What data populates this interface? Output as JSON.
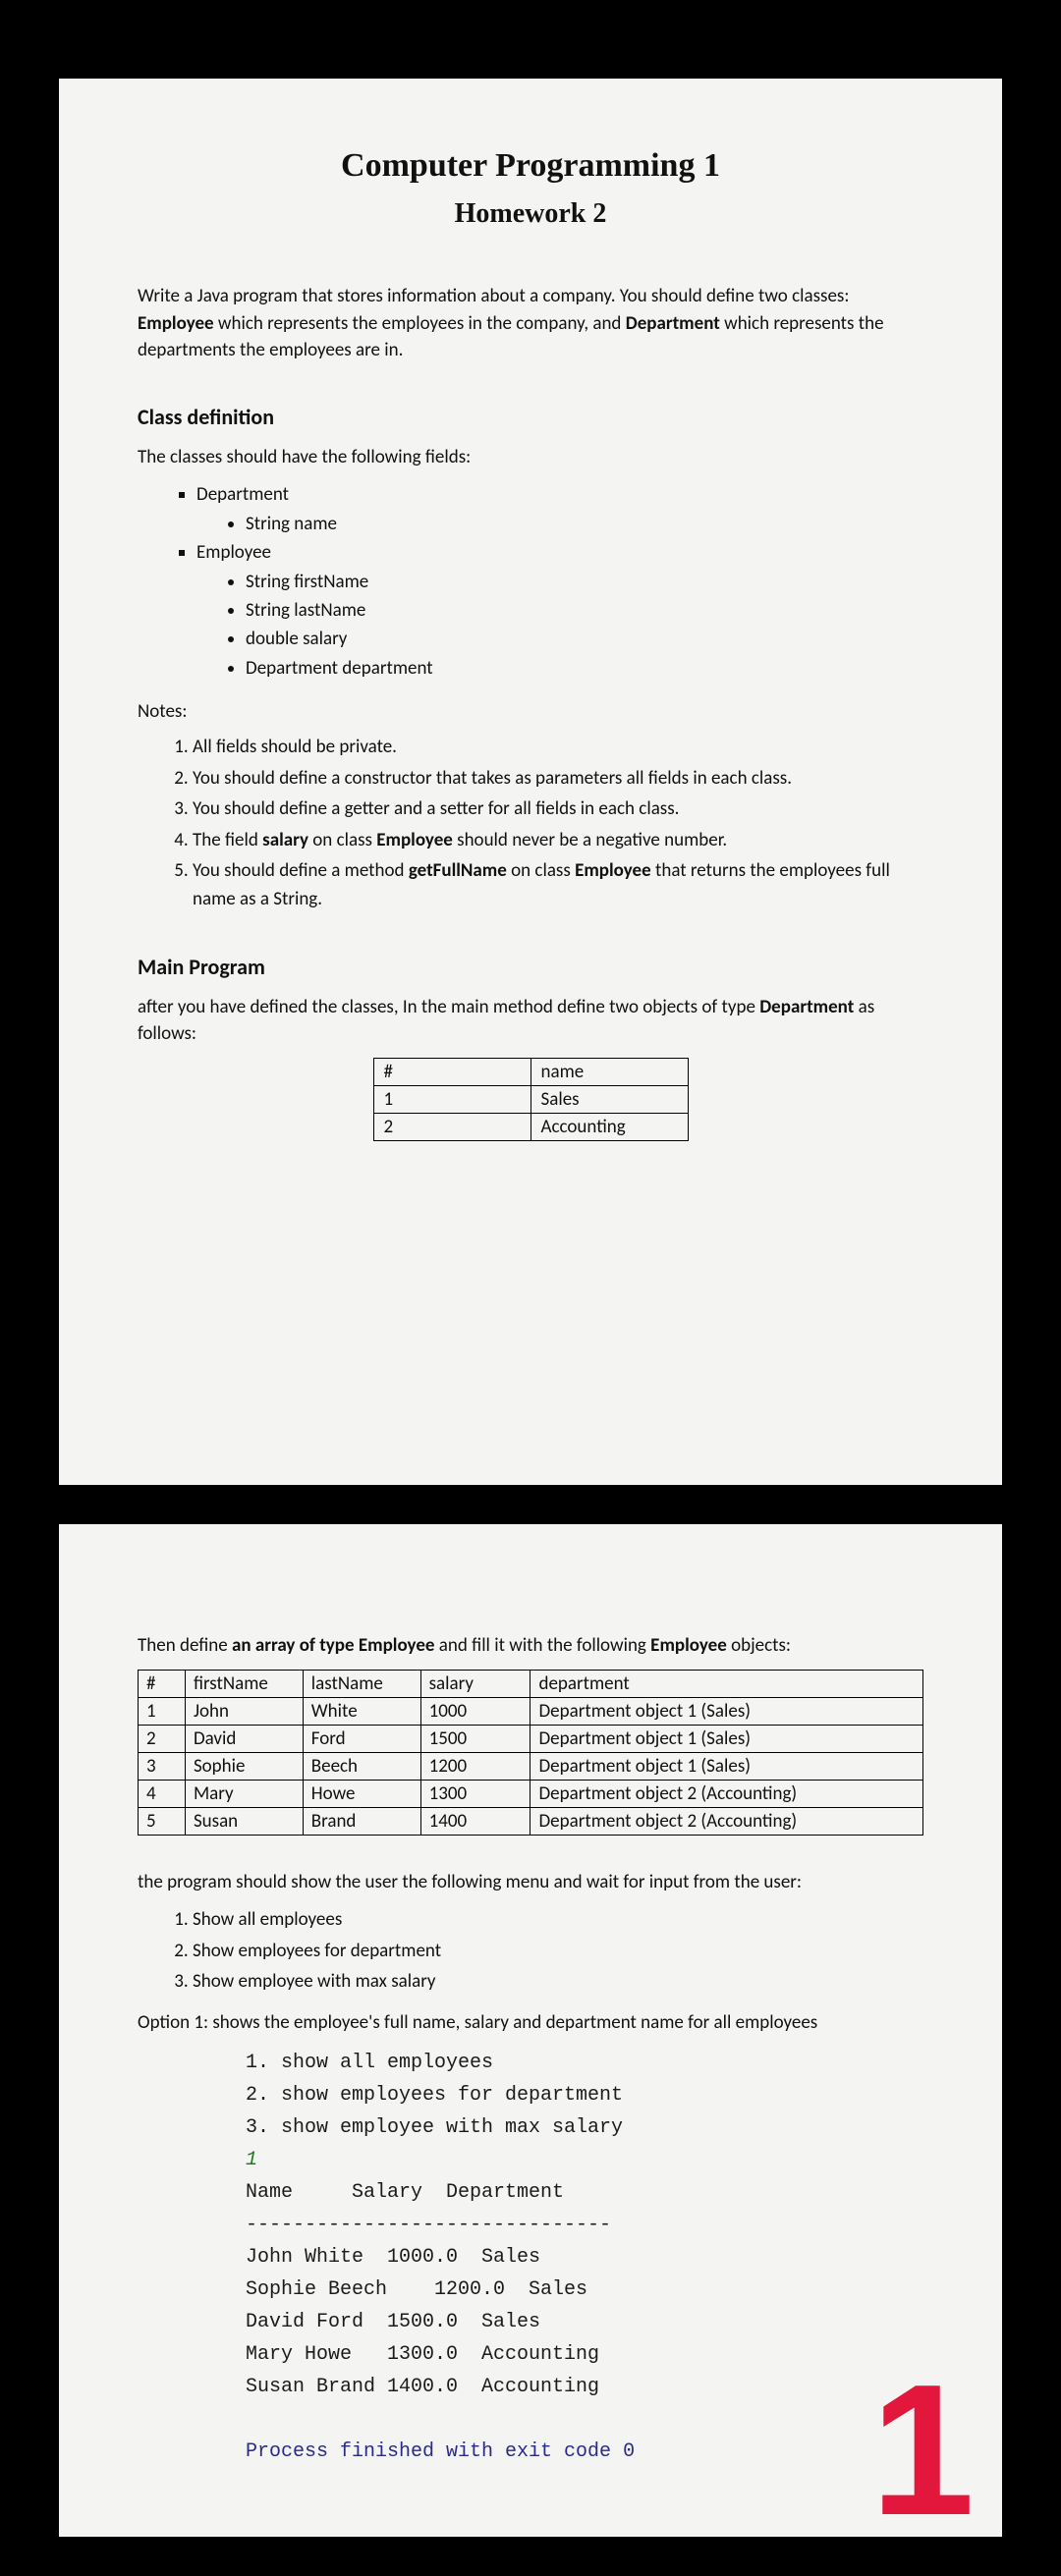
{
  "title": "Computer Programming 1",
  "subtitle": "Homework 2",
  "intro_pre": "Write a Java program that stores information about a company. You should define two classes: ",
  "intro_emp": "Employee",
  "intro_mid": " which represents the employees in the company, and ",
  "intro_dep": "Department",
  "intro_post": " which represents the departments the employees are in.",
  "h_classdef": "Class definition",
  "classdef_lead": "The classes should have the following fields:",
  "fields_department": "Department",
  "fields_department_items": [
    "String name"
  ],
  "fields_employee": "Employee",
  "fields_employee_items": [
    "String firstName",
    "String lastName",
    "double salary",
    "Department department"
  ],
  "notes_label": "Notes:",
  "notes": {
    "n1": "All fields should be private.",
    "n2": "You should define a constructor that takes as parameters all fields in each class.",
    "n3": "You should define a getter and a setter for all fields in each class.",
    "n4_pre": "The field ",
    "n4_b1": "salary",
    "n4_mid": " on class ",
    "n4_b2": "Employee",
    "n4_post": " should never be a negative number.",
    "n5_pre": "You should define a method ",
    "n5_b1": "getFullName",
    "n5_mid": " on class ",
    "n5_b2": "Employee",
    "n5_post": " that returns the employees full name as a String."
  },
  "h_main": "Main Program",
  "main_lead_pre": "after you have defined the classes, In the main method define two objects of type ",
  "main_lead_b": "Department",
  "main_lead_post": " as follows:",
  "dept_table": {
    "head": [
      "#",
      "name"
    ],
    "rows": [
      [
        "1",
        "Sales"
      ],
      [
        "2",
        "Accounting"
      ]
    ]
  },
  "page2_lead_pre": "Then define ",
  "page2_lead_b1": "an array of type Employee",
  "page2_lead_mid": " and fill it with the following ",
  "page2_lead_b2": "Employee",
  "page2_lead_post": " objects:",
  "emp_table": {
    "head": [
      "#",
      "firstName",
      "lastName",
      "salary",
      "department"
    ],
    "rows": [
      [
        "1",
        "John",
        "White",
        "1000",
        "Department object 1 (Sales)"
      ],
      [
        "2",
        "David",
        "Ford",
        "1500",
        "Department object 1 (Sales)"
      ],
      [
        "3",
        "Sophie",
        "Beech",
        "1200",
        "Department object 1 (Sales)"
      ],
      [
        "4",
        "Mary",
        "Howe",
        "1300",
        "Department object 2 (Accounting)"
      ],
      [
        "5",
        "Susan",
        "Brand",
        "1400",
        "Department object 2 (Accounting)"
      ]
    ]
  },
  "menu_lead": "the program should show the user the following menu and wait for input from the user:",
  "menu": [
    "Show all employees",
    "Show employees for department",
    "Show employee with max salary"
  ],
  "option1_desc": "Option 1: shows the employee's full name, salary and department name for all employees",
  "console": {
    "l1": "1. show all employees",
    "l2": "2. show employees for department",
    "l3": "3. show employee with max salary",
    "input": "1",
    "hdr": "Name     Salary  Department",
    "sep": "-------------------------------",
    "r1": "John White  1000.0  Sales",
    "r2": "Sophie Beech    1200.0  Sales",
    "r3": "David Ford  1500.0  Sales",
    "r4": "Mary Howe   1300.0  Accounting",
    "r5": "Susan Brand 1400.0  Accounting",
    "exit": "Process finished with exit code 0"
  },
  "page_number": "1"
}
